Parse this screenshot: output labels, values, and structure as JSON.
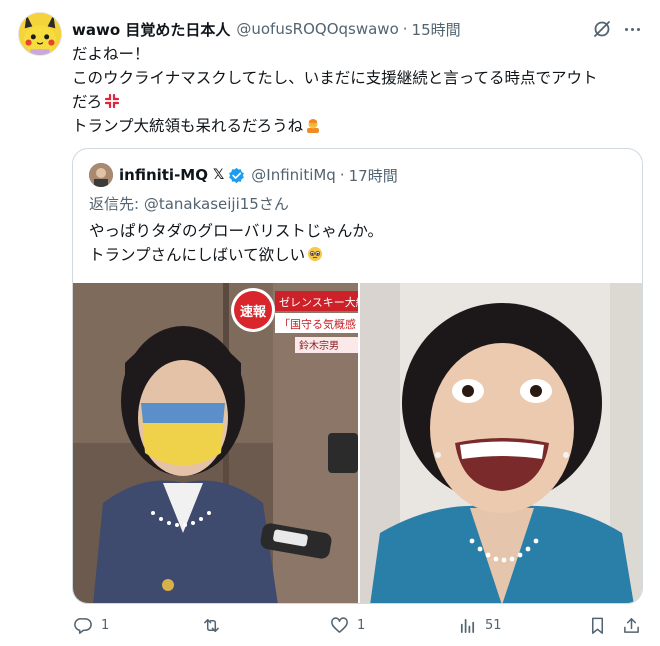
{
  "tweet": {
    "display_name": "wawo 目覚めた日本人",
    "handle": "@uofusROQOqswawo",
    "separator": "·",
    "time": "15時間",
    "lines": [
      "だよねー！",
      "このウクライナマスクしてたし、いまだに支援継続と言ってる時点でアウト",
      "だろ",
      "トランプ大統領も呆れるだろうね"
    ],
    "icons": {
      "anger": "anger-symbol-emoji",
      "facepalm": "person-facepalming-emoji",
      "grok": "grok-icon",
      "more": "more-icon"
    }
  },
  "quote": {
    "display_name": "infiniti-MQ",
    "x_mark": "𝕏",
    "handle": "@InfinitiMq",
    "separator": "·",
    "time": "17時間",
    "reply_to": "返信先: @tanakaseiji15さん",
    "lines": [
      "やっぱりタダのグローバリストじゃんか。",
      "トランプさんにしばいて欲しい"
    ],
    "icons": {
      "verified": "verified-badge-icon",
      "pleading": "pleading-face-emoji"
    },
    "photo_left": {
      "badge": "速報",
      "caption_top": "ゼレンスキー大統",
      "caption_mid": "「国守る気概感じ",
      "caption_bottom": "鈴木宗男"
    }
  },
  "actions": {
    "reply_count": "1",
    "retweet_count": "",
    "like_count": "1",
    "views_count": "51"
  },
  "colors": {
    "text": "#0f1419",
    "secondary": "#536471",
    "border": "#cfd9de",
    "verified": "#1d9bf0",
    "news_red": "#d8262c"
  }
}
